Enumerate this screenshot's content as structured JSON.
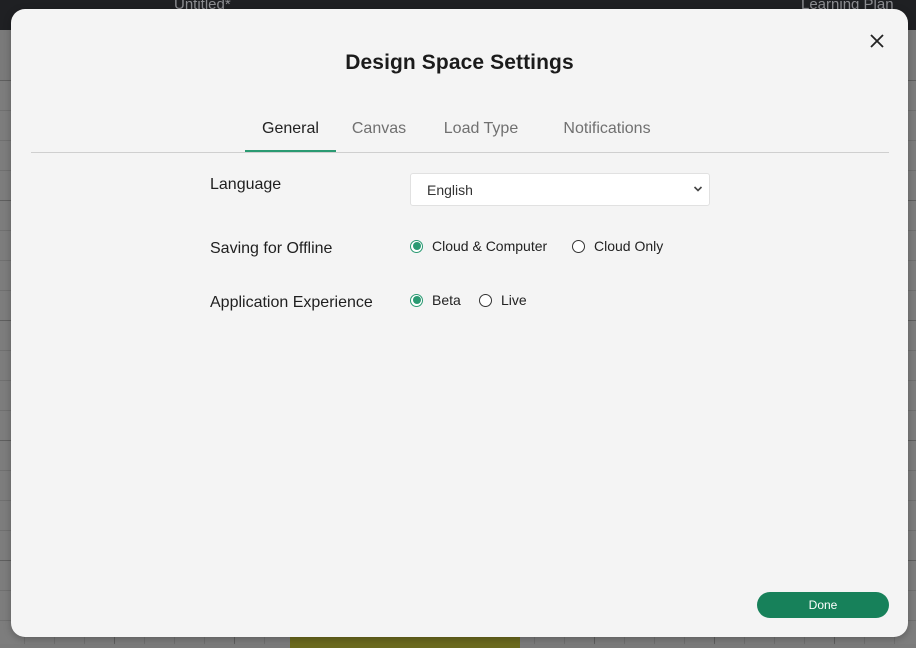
{
  "backdrop": {
    "document_title": "Untitled*",
    "right_link": "Learning Plan"
  },
  "modal": {
    "title": "Design Space Settings",
    "close_icon": "close-icon",
    "tabs": [
      {
        "label": "General",
        "active": true
      },
      {
        "label": "Canvas",
        "active": false
      },
      {
        "label": "Load Type",
        "active": false
      },
      {
        "label": "Notifications",
        "active": false
      }
    ],
    "settings": {
      "language": {
        "label": "Language",
        "selected": "English"
      },
      "saving_offline": {
        "label": "Saving for Offline",
        "options": [
          {
            "label": "Cloud & Computer",
            "checked": true
          },
          {
            "label": "Cloud Only",
            "checked": false
          }
        ]
      },
      "app_experience": {
        "label": "Application Experience",
        "options": [
          {
            "label": "Beta",
            "checked": true
          },
          {
            "label": "Live",
            "checked": false
          }
        ]
      }
    },
    "done_label": "Done"
  },
  "colors": {
    "accent": "#2a9a72",
    "button": "#17815a",
    "modal_bg": "#f4f4f4",
    "topbar": "#1f2023"
  }
}
